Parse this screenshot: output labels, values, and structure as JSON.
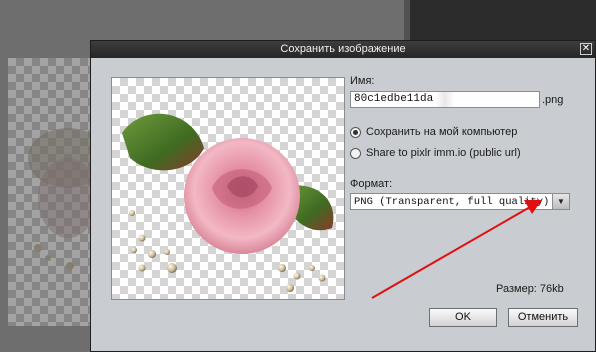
{
  "dialog": {
    "title": "Сохранить изображение",
    "close_glyph": "✕"
  },
  "form": {
    "name_label": "Имя:",
    "name_value": "80c1edbe11da",
    "extension": ".png",
    "radio_options": [
      {
        "label": "Сохранить на мой компьютер",
        "checked": true
      },
      {
        "label": "Share to pixlr imm.io (public url)",
        "checked": false
      }
    ],
    "format_label": "Формат:",
    "format_value": "PNG (Transparent, full quality)",
    "size_text": "Размер: 76kb"
  },
  "buttons": {
    "ok": "OK",
    "cancel": "Отменить"
  },
  "colors": {
    "annotation_arrow": "#e01010",
    "dialog_bg": "#c9cdd1"
  },
  "icons": {
    "close": "close-icon",
    "dropdown": "chevron-down-icon"
  }
}
